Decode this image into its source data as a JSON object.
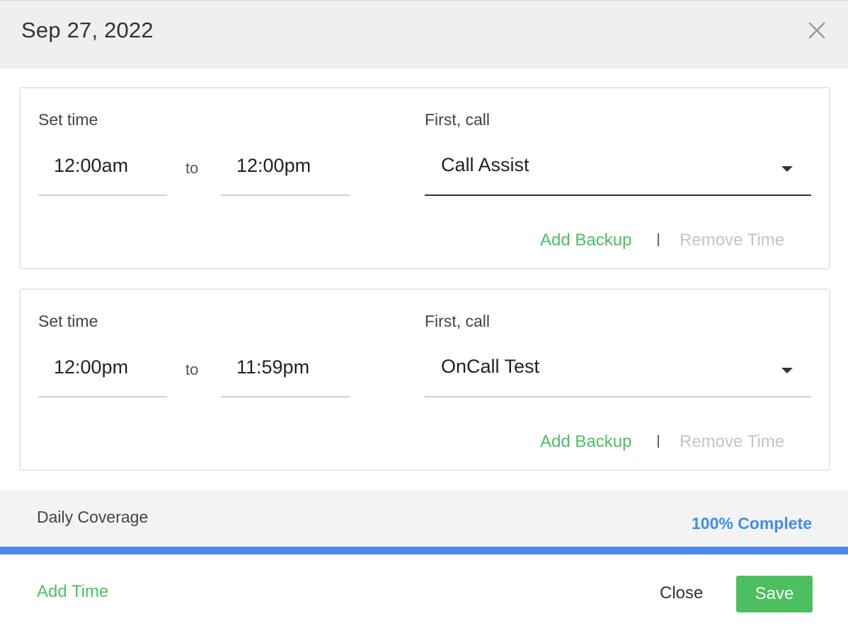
{
  "header": {
    "title": "Sep 27, 2022",
    "close_icon": "close-x-icon"
  },
  "slots": [
    {
      "set_time_label": "Set time",
      "start": "12:00am",
      "to_label": "to",
      "end": "12:00pm",
      "first_call_label": "First, call",
      "first_call_value": "Call Assist",
      "add_backup": "Add Backup",
      "divider": "|",
      "remove_time": "Remove Time"
    },
    {
      "set_time_label": "Set time",
      "start": "12:00pm",
      "to_label": "to",
      "end": "11:59pm",
      "first_call_label": "First, call",
      "first_call_value": "OnCall Test",
      "add_backup": "Add Backup",
      "divider": "|",
      "remove_time": "Remove Time"
    }
  ],
  "coverage": {
    "label": "Daily Coverage",
    "status": "100% Complete",
    "progress_percent": 100
  },
  "footer": {
    "add_time": "Add Time",
    "close": "Close",
    "save": "Save"
  },
  "colors": {
    "accent_green": "#4cbf60",
    "progress_blue": "#4a8ae6",
    "status_blue": "#3e8ee8",
    "muted_gray": "#c4c4c4"
  }
}
